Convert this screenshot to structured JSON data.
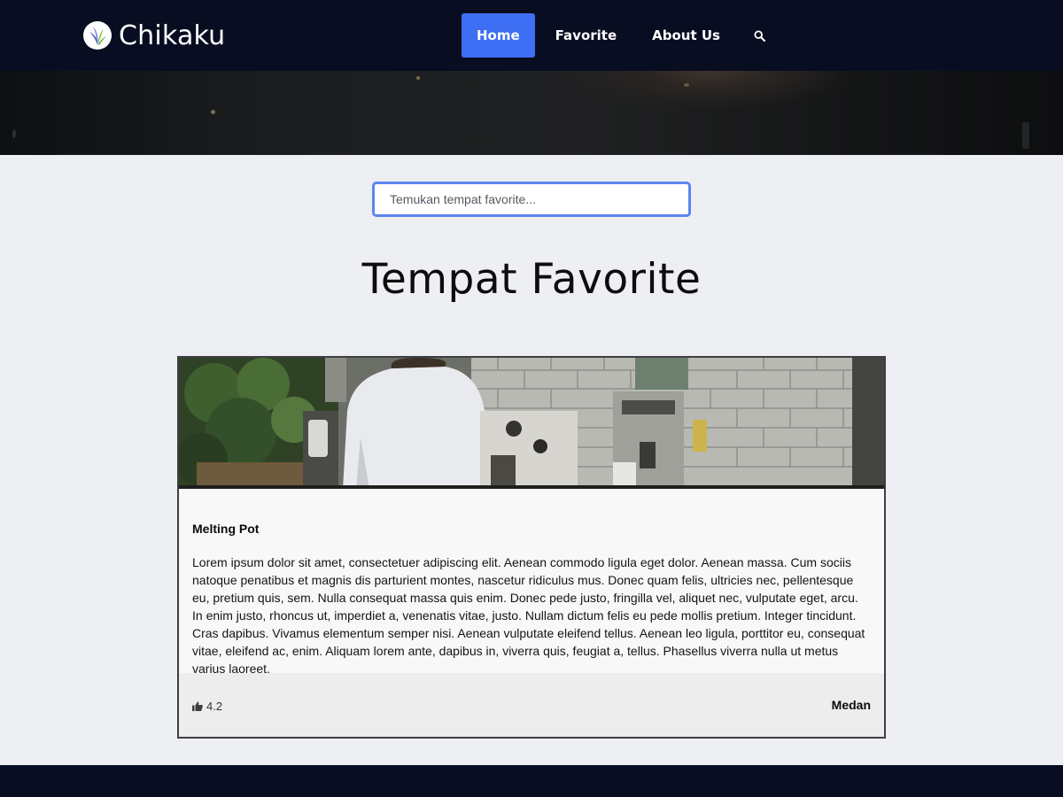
{
  "brand": {
    "name": "Chikaku",
    "logo_icon": "leaf-logo-icon"
  },
  "nav": {
    "items": [
      {
        "label": "Home",
        "active": true
      },
      {
        "label": "Favorite",
        "active": false
      },
      {
        "label": "About Us",
        "active": false
      }
    ],
    "search_icon": "search-icon"
  },
  "search": {
    "placeholder": "Temukan tempat favorite..."
  },
  "section": {
    "title": "Tempat Favorite"
  },
  "restaurants": [
    {
      "name": "Melting Pot",
      "description": "Lorem ipsum dolor sit amet, consectetuer adipiscing elit. Aenean commodo ligula eget dolor. Aenean massa. Cum sociis natoque penatibus et magnis dis parturient montes, nascetur ridiculus mus. Donec quam felis, ultricies nec, pellentesque eu, pretium quis, sem. Nulla consequat massa quis enim. Donec pede justo, fringilla vel, aliquet nec, vulputate eget, arcu. In enim justo, rhoncus ut, imperdiet a, venenatis vitae, justo. Nullam dictum felis eu pede mollis pretium. Integer tincidunt. Cras dapibus. Vivamus elementum semper nisi. Aenean vulputate eleifend tellus. Aenean leo ligula, porttitor eu, consequat vitae, eleifend ac, enim. Aliquam lorem ante, dapibus in, viverra quis, feugiat a, tellus. Phasellus viverra nulla ut metus varius laoreet.",
      "rating": "4.2",
      "rating_icon": "thumbs-up-icon",
      "city": "Medan"
    }
  ],
  "colors": {
    "navbar": "#080d21",
    "accent": "#3d6ef3",
    "page_background": "#eeeff3",
    "search_border": "#5a86ee"
  }
}
